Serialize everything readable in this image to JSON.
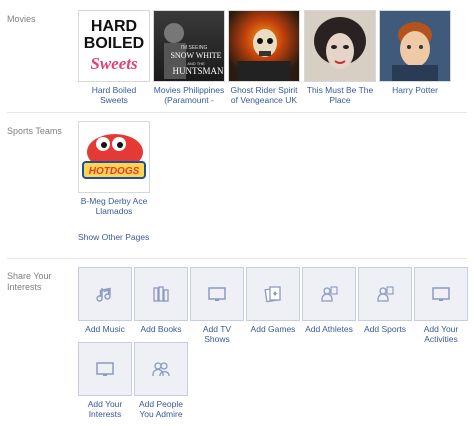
{
  "movies": {
    "label": "Movies",
    "items": [
      {
        "caption": "Hard Boiled Sweets",
        "poster_text": [
          "HARD",
          "BOILED",
          "Sweets"
        ]
      },
      {
        "caption": "Movies Philippines (Paramount -",
        "poster_text": [
          "I'M SEEING",
          "SNOW WHITE",
          "AND THE",
          "HUNTSMAN"
        ]
      },
      {
        "caption": "Ghost Rider Spirit of Vengeance UK"
      },
      {
        "caption": "This Must Be The Place"
      },
      {
        "caption": "Harry Potter"
      }
    ]
  },
  "sports": {
    "label": "Sports Teams",
    "items": [
      {
        "caption": "B-Meg Derby Ace Llamados",
        "logo_text": "HOTDOGS"
      }
    ],
    "show_other": "Show Other Pages"
  },
  "share": {
    "label": "Share Your Interests",
    "items": [
      {
        "label": "Add Music",
        "icon": "music-icon"
      },
      {
        "label": "Add Books",
        "icon": "books-icon"
      },
      {
        "label": "Add TV Shows",
        "icon": "tv-icon"
      },
      {
        "label": "Add Games",
        "icon": "games-icon"
      },
      {
        "label": "Add Athletes",
        "icon": "athletes-icon"
      },
      {
        "label": "Add Sports",
        "icon": "sports-icon"
      },
      {
        "label": "Add Your Activities",
        "icon": "activities-icon"
      },
      {
        "label": "Add Your Interests",
        "icon": "interests-icon"
      },
      {
        "label": "Add People You Admire",
        "icon": "people-icon"
      }
    ]
  },
  "colors": {
    "link": "#3b5998",
    "label": "#808080",
    "tile_bg": "#eef0f6",
    "tile_border": "#c6cde0",
    "icon": "#8b9ac0"
  }
}
